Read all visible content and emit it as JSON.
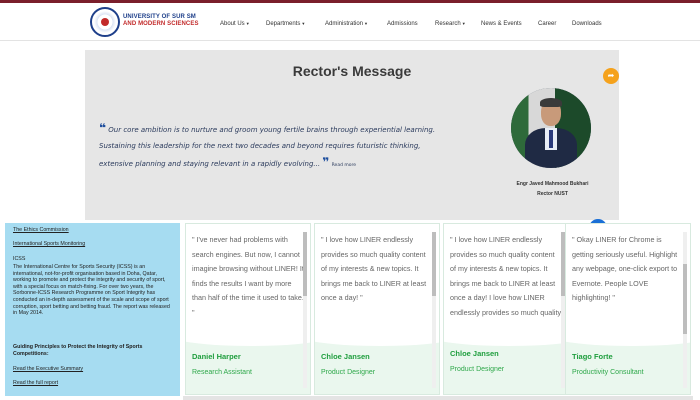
{
  "header": {
    "university_line1": "UNIVERSITY OF SUR SM",
    "university_line2": "AND MODERN SCIENCES",
    "nav": [
      {
        "label": "About Us",
        "dropdown": true
      },
      {
        "label": "Departments",
        "dropdown": true
      },
      {
        "label": "Administration",
        "dropdown": true
      },
      {
        "label": "Admissions",
        "dropdown": false
      },
      {
        "label": "Research",
        "dropdown": true
      },
      {
        "label": "News & Events",
        "dropdown": false
      },
      {
        "label": "Career",
        "dropdown": false
      },
      {
        "label": "Downloads",
        "dropdown": false
      }
    ],
    "chevron_icon": "chevron-down-icon"
  },
  "rector": {
    "title": "Rector's Message",
    "quote": "Our core ambition is to nurture and groom young fertile brains through experiential learning. Sustaining this leadership for the next two decades and beyond requires futuristic thinking, extensive planning and staying relevant in a rapidly evolving...",
    "read_more": "Read more",
    "name": "Engr Javed Mahmood Bukhari",
    "position": "Rector NUST",
    "share_icon": "share-icon"
  },
  "left_panel": {
    "link_ethics": "The Ethics Commission",
    "link_monitoring": "International Sports Monitoring",
    "icss_heading": "ICSS",
    "icss_body": "The International Centre for Sports Security (ICSS) is an international, not-for-profit organisation based in Doha, Qatar, working to promote and protect the integrity and security of sport, with a special focus on match-fixing. For over two years, the Sorbonne-ICSS Research Programme on Sport Integrity has conducted an in-depth assessment of the scale and scope of sport corruption, sport betting and betting fraud. The report was released in May 2014.",
    "guiding": "Guiding Principles to Protect the Integrity of Sports Competitions:",
    "link_summary": "Read the Executive Summary",
    "link_report": "Read the full report"
  },
  "testimonials": [
    {
      "quote": "\" I've never had problems with search engines. But now, I cannot imagine browsing without LINER! It finds the results I want by more than half of the time it used to take. \"",
      "name": "Daniel Harper",
      "role": "Research Assistant"
    },
    {
      "quote": "\" I love how LINER endlessly provides so much quality content of my interests & new topics. It brings me back to LINER at least once a day! \"",
      "name": "Chloe Jansen",
      "role": "Product Designer"
    },
    {
      "quote": "\" I love how LINER endlessly provides so much quality content of my interests & new topics. It brings me back to LINER at least once a day! I love how LINER endlessly provides so much quality content of my",
      "name": "Chloe Jansen",
      "role": "Product Designer"
    },
    {
      "quote": "\" Okay LINER for Chrome is getting seriously useful. Highlight any webpage, one-click export to Evernote. People LOVE highlighting! \"",
      "name": "Tiago Forte",
      "role": "Productivity Consultant"
    }
  ],
  "colors": {
    "accent_maroon": "#7a1f2b",
    "panel_blue": "#a6dcf1",
    "green": "#1f9e3e",
    "share_orange": "#f5a21c"
  }
}
